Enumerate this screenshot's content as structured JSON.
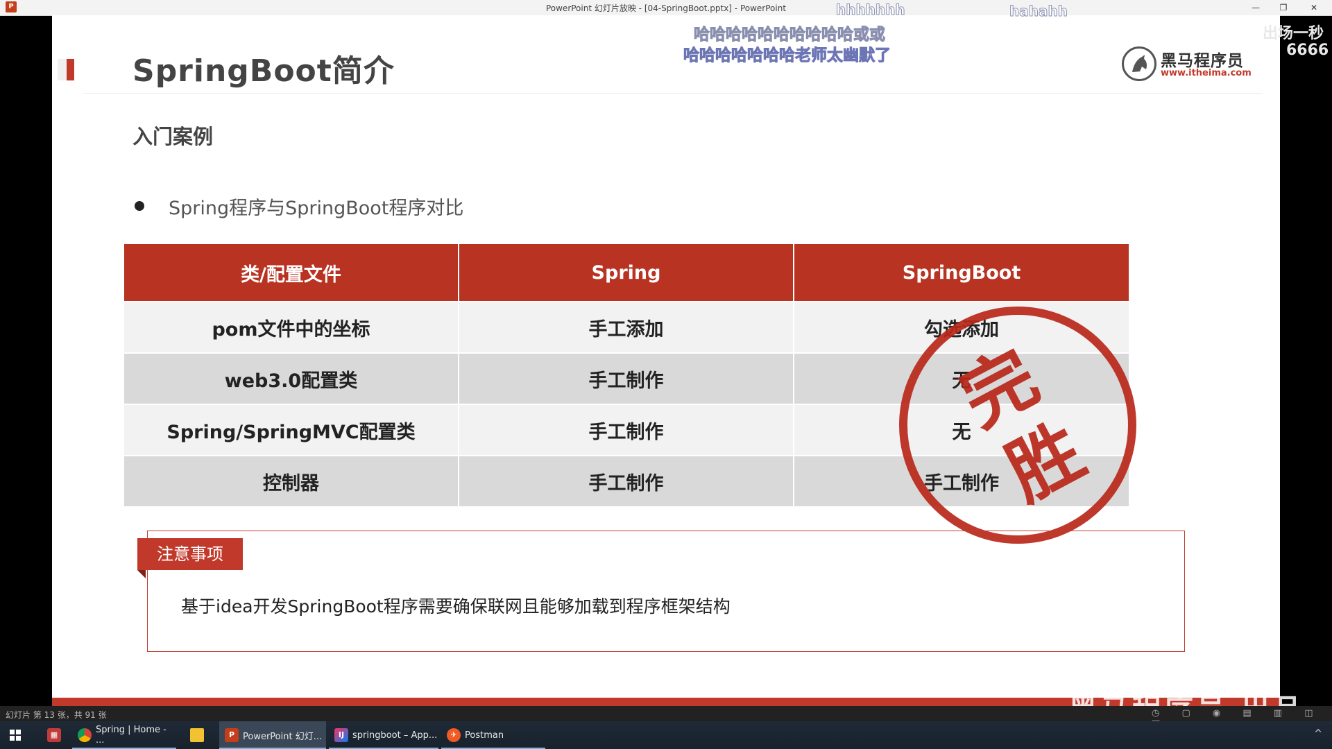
{
  "window": {
    "title": "PowerPoint 幻灯片放映 - [04-SpringBoot.pptx] - PowerPoint",
    "app_icon": "P",
    "minimize": "—",
    "restore": "❐",
    "close": "✕"
  },
  "slide": {
    "title": "SpringBoot简介",
    "section": "入门案例",
    "bullet": "Spring程序与SpringBoot程序对比",
    "logo": {
      "name": "黑马程序员",
      "url": "www.itheima.com"
    },
    "table": {
      "headers": [
        "类/配置文件",
        "Spring",
        "SpringBoot"
      ],
      "rows": [
        [
          "pom文件中的坐标",
          "手工添加",
          "勾选添加"
        ],
        [
          "web3.0配置类",
          "手工制作",
          "无"
        ],
        [
          "Spring/SpringMVC配置类",
          "手工制作",
          "无"
        ],
        [
          "控制器",
          "手工制作",
          "手工制作"
        ]
      ]
    },
    "stamp": {
      "char1": "完",
      "char2": "胜"
    },
    "note": {
      "tag": "注意事项",
      "text": "基于idea开发SpringBoot程序需要确保联网且能够加载到程序框架结构"
    },
    "watermark": "黑马程序员 出品"
  },
  "danmaku": [
    "hhhhhhh",
    "hahahh",
    "哈哈哈哈哈哈哈哈哈哈或或",
    "哈哈哈哈哈哈哈老师太幽默了",
    "出场一秒",
    "6666"
  ],
  "statusbar": {
    "slide_info": "幻灯片 第 13 张，共 91 张"
  },
  "taskbar": {
    "items": [
      {
        "label": "Spring | Home - ...",
        "icon": "chrome-icon"
      },
      {
        "label": "",
        "icon": "folder-icon"
      },
      {
        "label": "PowerPoint 幻灯...",
        "icon": "powerpoint-icon"
      },
      {
        "label": "springboot – App...",
        "icon": "intellij-icon"
      },
      {
        "label": "Postman",
        "icon": "postman-icon"
      }
    ],
    "tray": "^"
  },
  "colors": {
    "accent": "#c0392b",
    "header": "#b83322",
    "stamp": "#b8281a"
  }
}
